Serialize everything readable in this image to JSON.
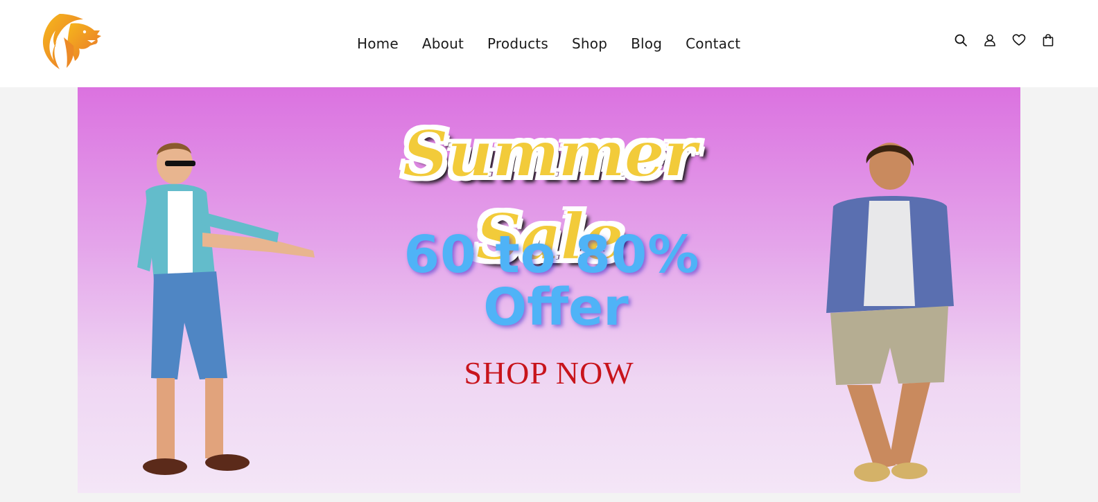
{
  "header": {
    "logo": {
      "icon": "lion-head-icon",
      "colors": [
        "#f4b400",
        "#e8732a"
      ]
    },
    "nav": [
      {
        "label": "Home"
      },
      {
        "label": "About"
      },
      {
        "label": "Products"
      },
      {
        "label": "Shop"
      },
      {
        "label": "Blog"
      },
      {
        "label": "Contact"
      }
    ],
    "icons": [
      "search-icon",
      "user-icon",
      "heart-icon",
      "shopping-bag-icon"
    ]
  },
  "banner": {
    "title": "Summer Sale",
    "offer_line_1": "60 to  80%",
    "offer_line_2": "Offer",
    "cta": "SHOP NOW",
    "colors": {
      "gradient_top": "#db72e0",
      "gradient_bottom": "#f4e6f7",
      "title": "#f2cb3a",
      "offer": "#4fb3f7",
      "cta": "#c8141c"
    }
  }
}
